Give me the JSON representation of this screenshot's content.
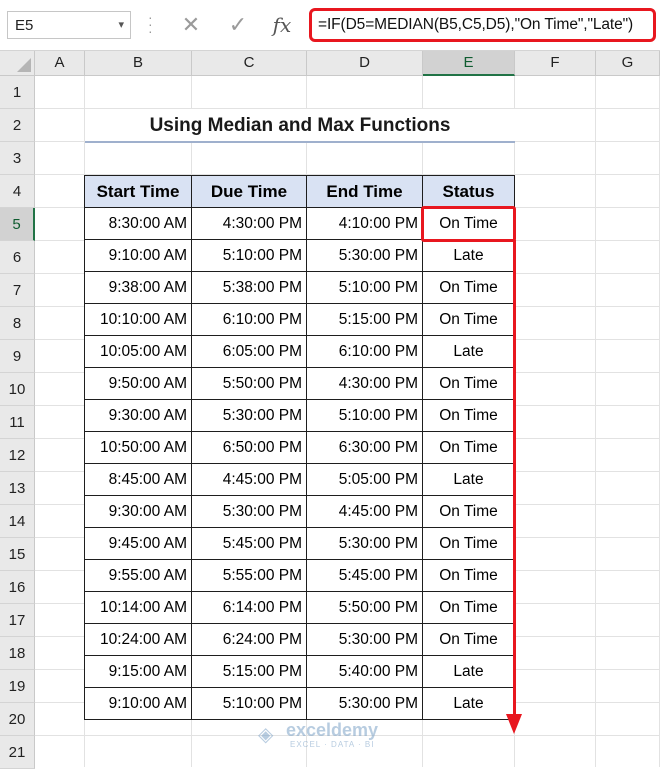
{
  "formula_bar": {
    "name_box": "E5",
    "name_box_arrow": "▾",
    "cancel_icon": "✕",
    "enter_icon": "✓",
    "fx_label": "fx",
    "formula": "=IF(D5=MEDIAN(B5,C5,D5),\"On Time\",\"Late\")"
  },
  "columns": [
    "A",
    "B",
    "C",
    "D",
    "E",
    "F",
    "G"
  ],
  "selected_column": "E",
  "rows": [
    "1",
    "2",
    "3",
    "4",
    "5",
    "6",
    "7",
    "8",
    "9",
    "10",
    "11",
    "12",
    "13",
    "14",
    "15",
    "16",
    "17",
    "18",
    "19",
    "20",
    "21"
  ],
  "selected_row": "5",
  "title": "Using Median and Max Functions",
  "table": {
    "headers": [
      "Start Time",
      "Due Time",
      "End Time",
      "Status"
    ],
    "rows": [
      [
        "8:30:00 AM",
        "4:30:00 PM",
        "4:10:00 PM",
        "On Time"
      ],
      [
        "9:10:00 AM",
        "5:10:00 PM",
        "5:30:00 PM",
        "Late"
      ],
      [
        "9:38:00 AM",
        "5:38:00 PM",
        "5:10:00 PM",
        "On Time"
      ],
      [
        "10:10:00 AM",
        "6:10:00 PM",
        "5:15:00 PM",
        "On Time"
      ],
      [
        "10:05:00 AM",
        "6:05:00 PM",
        "6:10:00 PM",
        "Late"
      ],
      [
        "9:50:00 AM",
        "5:50:00 PM",
        "4:30:00 PM",
        "On Time"
      ],
      [
        "9:30:00 AM",
        "5:30:00 PM",
        "5:10:00 PM",
        "On Time"
      ],
      [
        "10:50:00 AM",
        "6:50:00 PM",
        "6:30:00 PM",
        "On Time"
      ],
      [
        "8:45:00 AM",
        "4:45:00 PM",
        "5:05:00 PM",
        "Late"
      ],
      [
        "9:30:00 AM",
        "5:30:00 PM",
        "4:45:00 PM",
        "On Time"
      ],
      [
        "9:45:00 AM",
        "5:45:00 PM",
        "5:30:00 PM",
        "On Time"
      ],
      [
        "9:55:00 AM",
        "5:55:00 PM",
        "5:45:00 PM",
        "On Time"
      ],
      [
        "10:14:00 AM",
        "6:14:00 PM",
        "5:50:00 PM",
        "On Time"
      ],
      [
        "10:24:00 AM",
        "6:24:00 PM",
        "5:30:00 PM",
        "On Time"
      ],
      [
        "9:15:00 AM",
        "5:15:00 PM",
        "5:40:00 PM",
        "Late"
      ],
      [
        "9:10:00 AM",
        "5:10:00 PM",
        "5:30:00 PM",
        "Late"
      ]
    ]
  },
  "watermark": {
    "name": "exceldemy",
    "tagline": "EXCEL · DATA · BI"
  },
  "colors": {
    "highlight": "#e8171f",
    "header_fill": "#d9e2f3",
    "selection": "#217346"
  }
}
